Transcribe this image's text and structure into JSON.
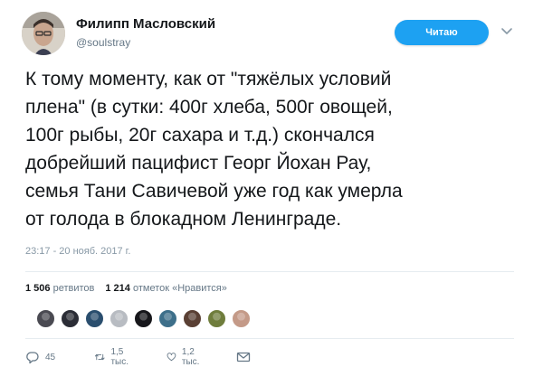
{
  "author": {
    "display_name": "Филипп Масловский",
    "handle": "@soulstray"
  },
  "follow_button": {
    "label": "Читаю"
  },
  "tweet": {
    "lines": [
      "К тому моменту, как от \"тяжёлых условий",
      "плена\" (в сутки: 400г хлеба, 500г овощей,",
      "100г рыбы, 20г сахара и т.д.) скончался",
      "добрейший пацифист Георг Йохан Рау,",
      "семья Тани Савичевой уже год как умерла",
      "от голода в блокадном Ленинграде."
    ],
    "timestamp": "23:17 - 20 нояб. 2017 г."
  },
  "stats": {
    "retweets_count": "1 506",
    "retweets_label": "ретвитов",
    "likes_count": "1 214",
    "likes_label": "отметок «Нравится»"
  },
  "likers": [
    {
      "color": "#4a4a52"
    },
    {
      "color": "#2b2d36"
    },
    {
      "color": "#2a4e6e"
    },
    {
      "color": "#b8bcc2"
    },
    {
      "color": "#17171b"
    },
    {
      "color": "#3d6f8a"
    },
    {
      "color": "#5a4034"
    },
    {
      "color": "#6f7d3c"
    },
    {
      "color": "#c49a88"
    }
  ],
  "actions": {
    "reply_count": "45",
    "retweet_count": "1,5 тыс.",
    "like_count": "1,2 тыс."
  },
  "colors": {
    "accent": "#1da1f2",
    "muted": "#657786",
    "text": "#14171a"
  }
}
